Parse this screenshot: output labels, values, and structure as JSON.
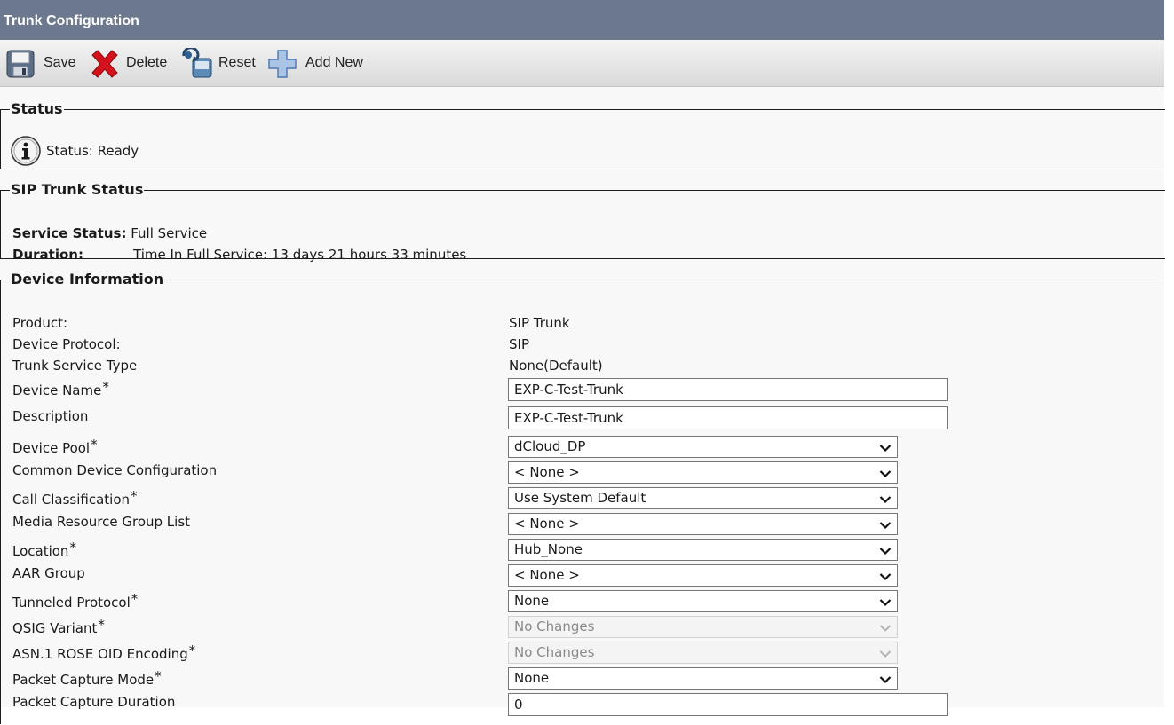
{
  "title": "Trunk Configuration",
  "toolbar": {
    "save": "Save",
    "delete": "Delete",
    "reset": "Reset",
    "add_new": "Add New"
  },
  "status": {
    "legend": "Status",
    "text": "Status: Ready"
  },
  "sip_trunk_status": {
    "legend": "SIP Trunk Status",
    "service_status_label": "Service Status:",
    "service_status_value": "Full Service",
    "duration_label": "Duration:",
    "duration_value": "Time In Full Service: 13 days 21 hours 33 minutes"
  },
  "device_info": {
    "legend": "Device Information",
    "required_mark": "*",
    "product_label": "Product:",
    "product_value": "SIP Trunk",
    "protocol_label": "Device Protocol:",
    "protocol_value": "SIP",
    "service_type_label": "Trunk Service Type",
    "service_type_value": "None(Default)",
    "device_name_label": "Device Name",
    "device_name_value": "EXP-C-Test-Trunk",
    "description_label": "Description",
    "description_value": "EXP-C-Test-Trunk",
    "device_pool_label": "Device Pool",
    "device_pool_value": "dCloud_DP",
    "common_config_label": "Common Device Configuration",
    "common_config_value": "< None >",
    "call_class_label": "Call Classification",
    "call_class_value": "Use System Default",
    "mrgl_label": "Media Resource Group List",
    "mrgl_value": "< None >",
    "location_label": "Location",
    "location_value": "Hub_None",
    "aar_label": "AAR Group",
    "aar_value": "< None >",
    "tunneled_label": "Tunneled Protocol",
    "tunneled_value": "None",
    "qsig_label": "QSIG Variant",
    "qsig_value": "No Changes",
    "asn_label": "ASN.1 ROSE OID Encoding",
    "asn_value": "No Changes",
    "capture_mode_label": "Packet Capture Mode",
    "capture_mode_value": "None",
    "capture_duration_label": "Packet Capture Duration",
    "capture_duration_value": "0"
  }
}
